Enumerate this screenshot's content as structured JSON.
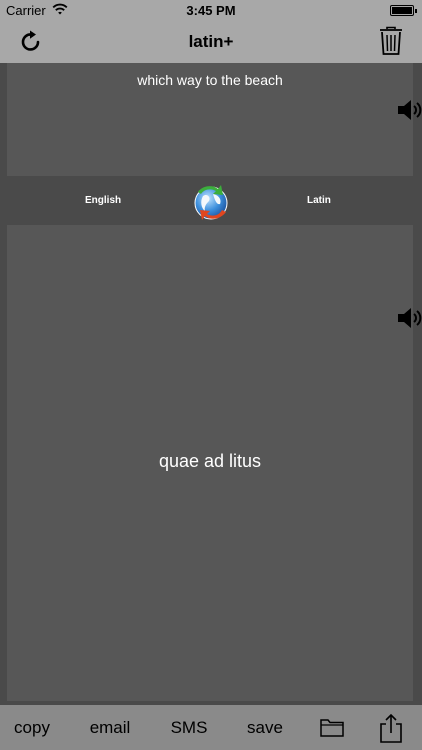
{
  "status_bar": {
    "carrier": "Carrier",
    "time": "3:45 PM"
  },
  "nav": {
    "title": "latin+",
    "left_icon": "refresh-icon",
    "right_icon": "trash-icon"
  },
  "input": {
    "text": "which way to the beach"
  },
  "languages": {
    "source": "English",
    "target": "Latin",
    "swap_icon": "globe-swap-icon"
  },
  "output": {
    "text": "quae ad litus"
  },
  "toolbar": {
    "copy_label": "copy",
    "email_label": "email",
    "sms_label": "SMS",
    "save_label": "save",
    "folder_icon": "folder-icon",
    "share_icon": "share-icon"
  },
  "colors": {
    "bars": "#a8a8a8",
    "background": "#4a4a4a",
    "panel": "#575757",
    "toolbar": "#8a8a8a"
  }
}
